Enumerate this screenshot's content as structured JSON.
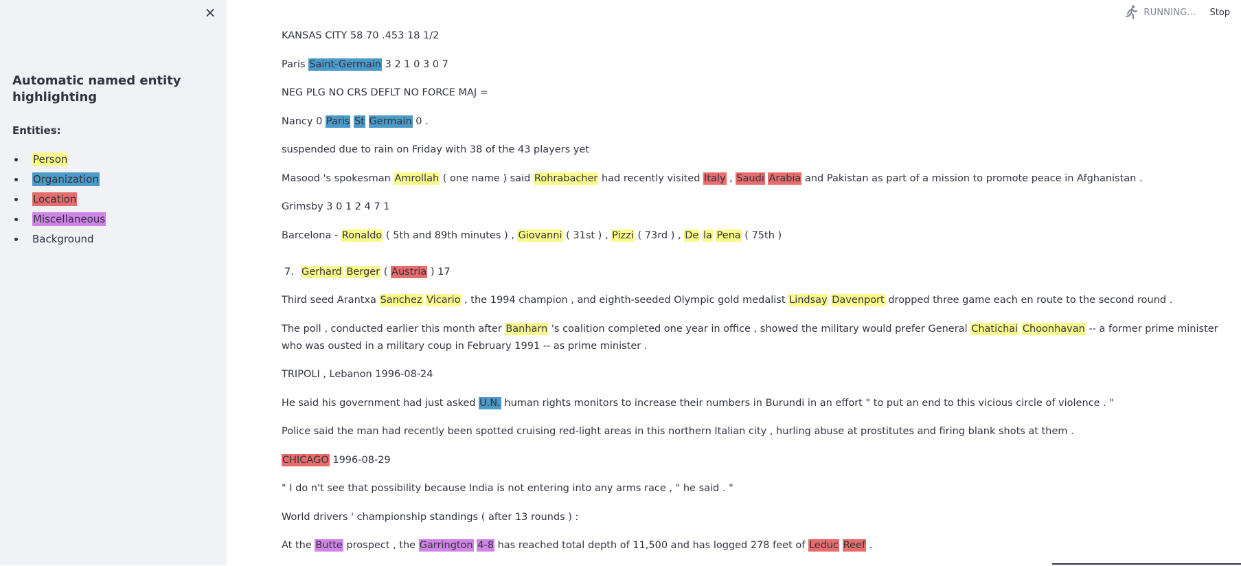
{
  "sidebar": {
    "close_label": "×",
    "title": "Automatic named entity highlighting",
    "entities_label": "Entities:",
    "legend": [
      {
        "label": "Person",
        "type": "PER"
      },
      {
        "label": "Organization",
        "type": "ORG"
      },
      {
        "label": "Location",
        "type": "LOC"
      },
      {
        "label": "Miscellaneous",
        "type": "MISC"
      },
      {
        "label": "Background",
        "type": "O"
      }
    ]
  },
  "status": {
    "running_label": "RUNNING...",
    "stop_label": "Stop",
    "icon": "running-man-icon"
  },
  "colors": {
    "PER": "#fafa8c",
    "ORG": "#4b9ac7",
    "LOC": "#e76d6d",
    "MISC": "#cf84e6",
    "sidebar_bg": "#f0f2f6"
  },
  "sentences": [
    {
      "tokens": [
        [
          "KANSAS CITY 58 70 .453 18 1/2",
          "O"
        ]
      ]
    },
    {
      "tokens": [
        [
          "Paris ",
          "O"
        ],
        [
          "Saint-Germain",
          "ORG"
        ],
        [
          " 3 2 1 0 3 0 7",
          "O"
        ]
      ]
    },
    {
      "tokens": [
        [
          "NEG PLG NO CRS DEFLT NO FORCE MAJ =",
          "O"
        ]
      ]
    },
    {
      "tokens": [
        [
          "Nancy 0 ",
          "O"
        ],
        [
          "Paris",
          "ORG"
        ],
        [
          " ",
          "O"
        ],
        [
          "St",
          "ORG"
        ],
        [
          " ",
          "O"
        ],
        [
          "Germain",
          "ORG"
        ],
        [
          " 0 .",
          "O"
        ]
      ]
    },
    {
      "tokens": [
        [
          "suspended due to rain on Friday with 38 of the 43 players yet",
          "O"
        ]
      ]
    },
    {
      "tokens": [
        [
          "Masood 's spokesman ",
          "O"
        ],
        [
          "Amrollah",
          "PER"
        ],
        [
          " ( one name ) said ",
          "O"
        ],
        [
          "Rohrabacher",
          "PER"
        ],
        [
          " had recently visited ",
          "O"
        ],
        [
          "Italy",
          "LOC"
        ],
        [
          " , ",
          "O"
        ],
        [
          "Saudi",
          "LOC"
        ],
        [
          " ",
          "O"
        ],
        [
          "Arabia",
          "LOC"
        ],
        [
          " and Pakistan as part of a mission to promote peace in Afghanistan .",
          "O"
        ]
      ]
    },
    {
      "tokens": [
        [
          "Grimsby 3 0 1 2 4 7 1",
          "O"
        ]
      ]
    },
    {
      "tokens": [
        [
          "Barcelona - ",
          "O"
        ],
        [
          "Ronaldo",
          "PER"
        ],
        [
          " ( 5th and 89th minutes ) , ",
          "O"
        ],
        [
          "Giovanni",
          "PER"
        ],
        [
          " ( 31st ) , ",
          "O"
        ],
        [
          "Pizzi",
          "PER"
        ],
        [
          " ( 73rd ) , ",
          "O"
        ],
        [
          "De",
          "PER"
        ],
        [
          " ",
          "O"
        ],
        [
          "la",
          "PER"
        ],
        [
          " ",
          "O"
        ],
        [
          "Pena",
          "PER"
        ],
        [
          " ( 75th )",
          "O"
        ]
      ]
    },
    {
      "number": "7.",
      "tokens": [
        [
          "Gerhard",
          "PER"
        ],
        [
          " ",
          "O"
        ],
        [
          "Berger",
          "PER"
        ],
        [
          " ( ",
          "O"
        ],
        [
          "Austria",
          "LOC"
        ],
        [
          " ) 17",
          "O"
        ]
      ]
    },
    {
      "tokens": [
        [
          "Third seed Arantxa ",
          "O"
        ],
        [
          "Sanchez",
          "PER"
        ],
        [
          " ",
          "O"
        ],
        [
          "Vicario",
          "PER"
        ],
        [
          " , the 1994 champion , and eighth-seeded Olympic gold medalist ",
          "O"
        ],
        [
          "Lindsay",
          "PER"
        ],
        [
          " ",
          "O"
        ],
        [
          "Davenport",
          "PER"
        ],
        [
          " dropped three game each en route to the second round .",
          "O"
        ]
      ]
    },
    {
      "wrap": true,
      "tokens": [
        [
          "The poll , conducted earlier this month after ",
          "O"
        ],
        [
          "Banharn",
          "PER"
        ],
        [
          " 's coalition completed one year in office , showed the military would prefer General ",
          "O"
        ],
        [
          "Chatichai",
          "PER"
        ],
        [
          " ",
          "O"
        ],
        [
          "Choonhavan",
          "PER"
        ],
        [
          " -- a former prime minister who was ousted in a military coup in February 1991 -- as prime minister .",
          "O"
        ]
      ]
    },
    {
      "tokens": [
        [
          "TRIPOLI , Lebanon 1996-08-24",
          "O"
        ]
      ]
    },
    {
      "tokens": [
        [
          "He said his government had just asked ",
          "O"
        ],
        [
          "U.N.",
          "ORG"
        ],
        [
          " human rights monitors to increase their numbers in Burundi in an effort \" to put an end to this vicious circle of violence . \"",
          "O"
        ]
      ]
    },
    {
      "tokens": [
        [
          "Police said the man had recently been spotted cruising red-light areas in this northern Italian city , hurling abuse at prostitutes and firing blank shots at them .",
          "O"
        ]
      ]
    },
    {
      "tokens": [
        [
          "CHICAGO",
          "LOC"
        ],
        [
          " 1996-08-29",
          "O"
        ]
      ]
    },
    {
      "tokens": [
        [
          "\" I do n't see that possibility because India is not entering into any arms race , \" he said . \"",
          "O"
        ]
      ]
    },
    {
      "tokens": [
        [
          "World drivers ' championship standings ( after 13 rounds ) :",
          "O"
        ]
      ]
    },
    {
      "tokens": [
        [
          "At the ",
          "O"
        ],
        [
          "Butte",
          "MISC"
        ],
        [
          " prospect , the ",
          "O"
        ],
        [
          "Garrington",
          "MISC"
        ],
        [
          " ",
          "O"
        ],
        [
          "4-8",
          "MISC"
        ],
        [
          " has reached total depth of 11,500 and has logged 278 feet of ",
          "O"
        ],
        [
          "Leduc",
          "LOC"
        ],
        [
          " ",
          "O"
        ],
        [
          "Reef",
          "LOC"
        ],
        [
          " .",
          "O"
        ]
      ]
    }
  ]
}
